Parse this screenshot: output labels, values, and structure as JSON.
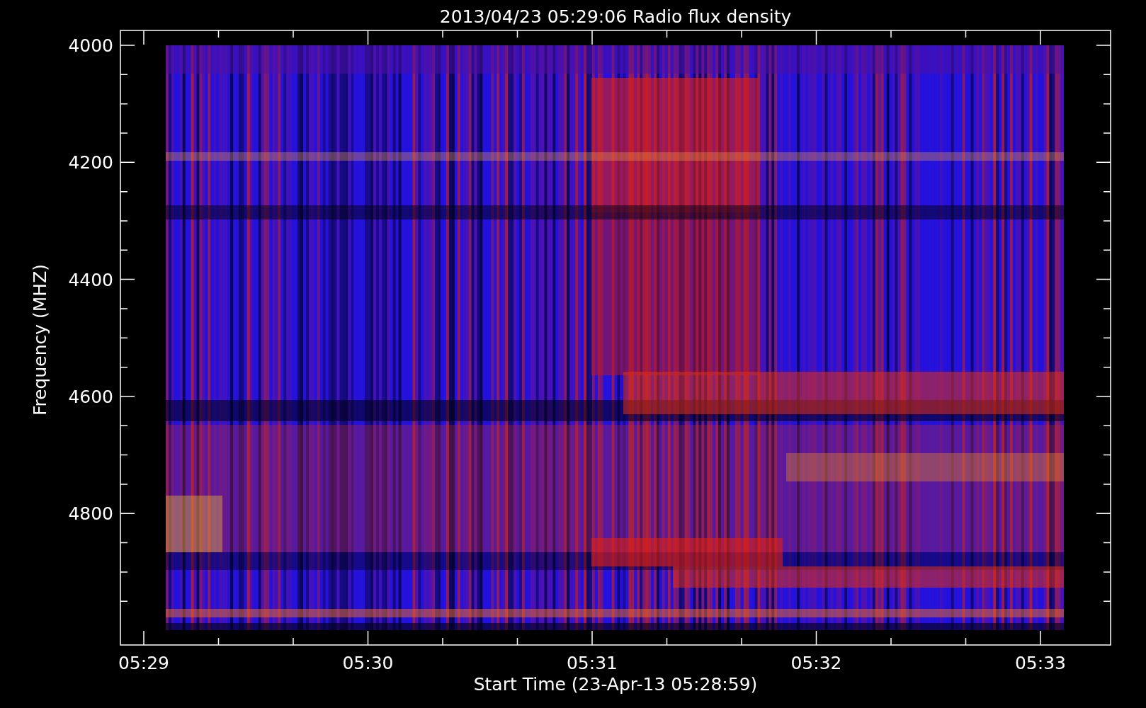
{
  "chart": {
    "title": "2013/04/23 05:29:06 Radio flux density",
    "ylabel": "Frequency (MHZ)",
    "xlabel": "Start Time (23-Apr-13 05:28:59)",
    "yticks": [
      "4000",
      "4200",
      "4400",
      "4600",
      "4800"
    ],
    "xticks": [
      "05:29",
      "05:30",
      "05:31",
      "05:32",
      "05:33"
    ]
  }
}
